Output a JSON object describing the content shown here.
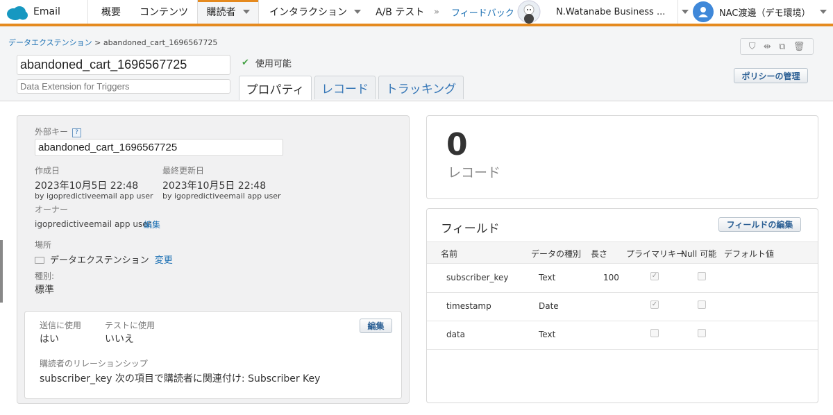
{
  "nav": {
    "app_name": "Email",
    "items": [
      "概要",
      "コンテンツ",
      "購読者",
      "インタラクション",
      "A/B テスト",
      "フィードバック"
    ],
    "business_unit": "N.Watanabe Business ...",
    "user": "NAC渡邊（デモ環境）"
  },
  "breadcrumb": {
    "parent": "データエクステンション",
    "current": "abandoned_cart_1696567725"
  },
  "header": {
    "name_value": "abandoned_cart_1696567725",
    "description_value": "Data Extension for Triggers",
    "status": "使用可能",
    "policy_button": "ポリシーの管理"
  },
  "tabs": [
    "プロパティ",
    "レコード",
    "トラッキング"
  ],
  "properties": {
    "external_key_label": "外部キー",
    "external_key_help": "?",
    "external_key_value": "abandoned_cart_1696567725",
    "created_label": "作成日",
    "created_value": "2023年10月5日 22:48",
    "created_by": "by igopredictiveemail app user",
    "modified_label": "最終更新日",
    "modified_value": "2023年10月5日 22:48",
    "modified_by": "by igopredictiveemail app user",
    "owner_label": "オーナー",
    "owner_value": "igopredictiveemail app user",
    "owner_edit": "編集",
    "location_label": "場所",
    "location_value": "データエクステンション",
    "location_change": "変更",
    "type_label": "種別:",
    "type_value": "標準"
  },
  "usage": {
    "sendable_label": "送信に使用",
    "sendable_value": "はい",
    "testable_label": "テストに使用",
    "testable_value": "いいえ",
    "edit_button": "編集",
    "relationship_label": "購読者のリレーションシップ",
    "relationship_value": "subscriber_key 次の項目で購読者に関連付け: Subscriber Key"
  },
  "records": {
    "count": "0",
    "label": "レコード"
  },
  "fields": {
    "title": "フィールド",
    "edit_button": "フィールドの編集",
    "columns": [
      "名前",
      "データの種別",
      "長さ",
      "プライマリキー",
      "Null 可能",
      "デフォルト値"
    ],
    "rows": [
      {
        "name": "subscriber_key",
        "type": "Text",
        "length": "100",
        "primary": true,
        "nullable": false
      },
      {
        "name": "timestamp",
        "type": "Date",
        "length": "",
        "primary": true,
        "nullable": false
      },
      {
        "name": "data",
        "type": "Text",
        "length": "",
        "primary": false,
        "nullable": false
      }
    ]
  }
}
